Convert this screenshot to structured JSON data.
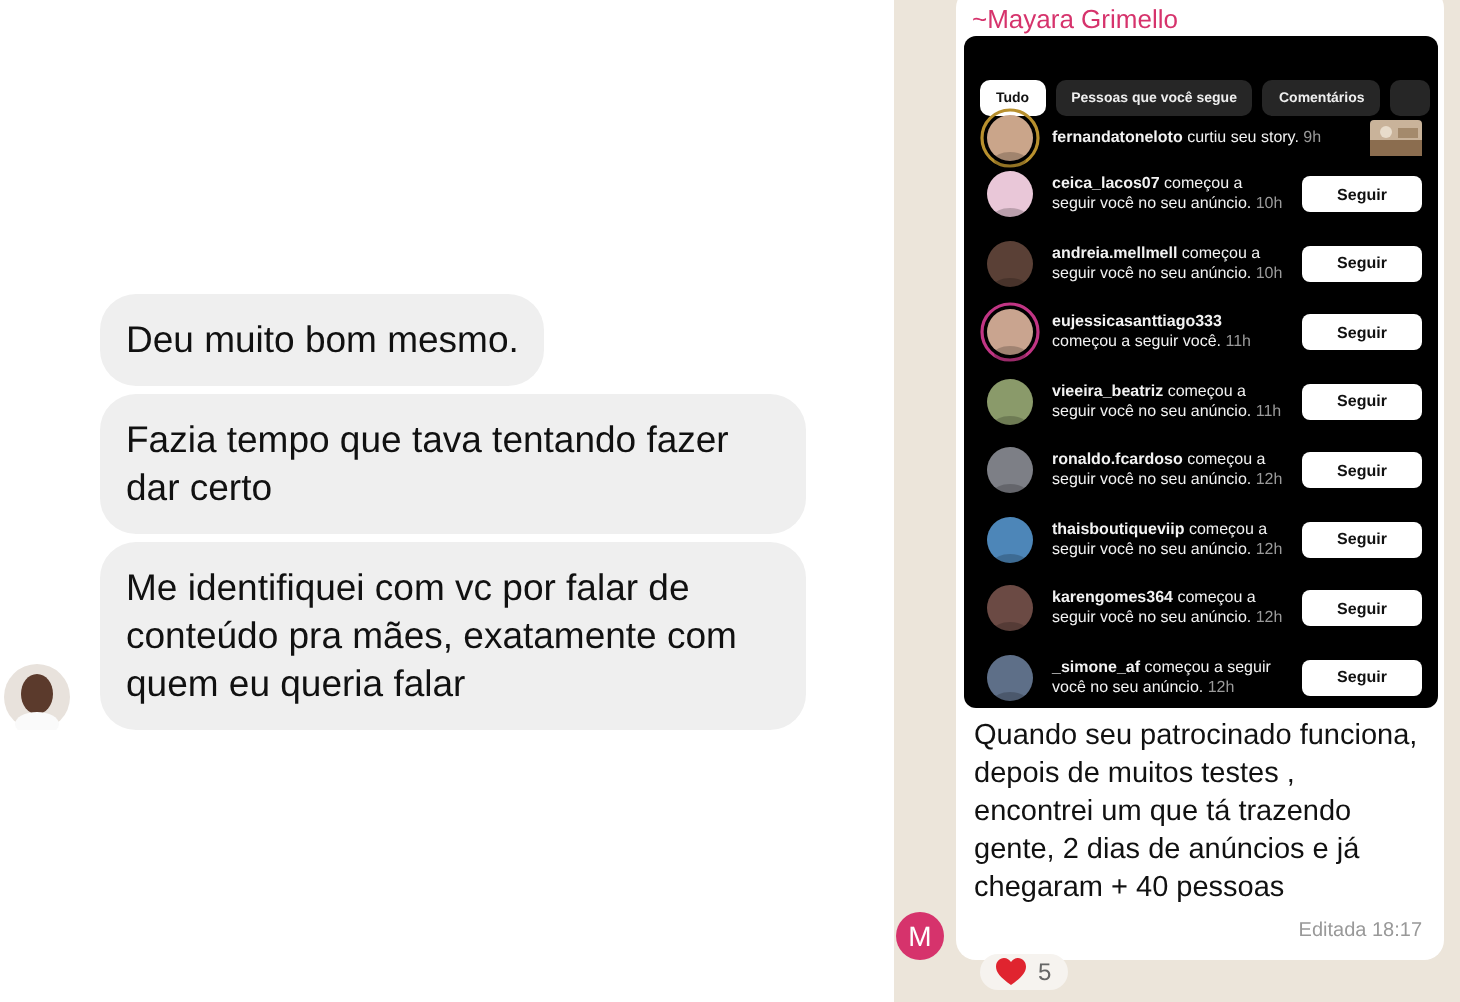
{
  "left_chat": {
    "messages": [
      {
        "text": "Deu muito bom mesmo."
      },
      {
        "text": "Fazia tempo que tava tentando fazer dar certo"
      },
      {
        "text": "Me identifiquei com vc por falar de conteúdo pra mães, exatamente com quem eu queria falar"
      }
    ]
  },
  "right_chat": {
    "sender": "~Mayara Grimello",
    "sender_initial": "M",
    "screenshot": {
      "tabs": [
        {
          "label": "Tudo",
          "selected": true
        },
        {
          "label": "Pessoas que você segue",
          "selected": false
        },
        {
          "label": "Comentários",
          "selected": false
        }
      ],
      "notifications": [
        {
          "kind": "like",
          "username": "fernandatoneloto",
          "action": "curtiu seu story.",
          "time": "9h",
          "story_ring": true
        },
        {
          "kind": "follow",
          "username": "ceica_lacos07",
          "action": "começou a seguir você no seu anúncio.",
          "time": "10h",
          "button": "Seguir",
          "story_ring": false
        },
        {
          "kind": "follow",
          "username": "andreia.mellmell",
          "action": "começou a seguir você no seu anúncio.",
          "time": "10h",
          "button": "Seguir",
          "story_ring": false
        },
        {
          "kind": "follow",
          "username": "eujessicasanttiago333",
          "action": "começou a seguir você.",
          "time": "11h",
          "button": "Seguir",
          "story_ring": true
        },
        {
          "kind": "follow",
          "username": "vieeira_beatriz",
          "action": "começou a seguir você no seu anúncio.",
          "time": "11h",
          "button": "Seguir",
          "story_ring": false
        },
        {
          "kind": "follow",
          "username": "ronaldo.fcardoso",
          "action": "começou a seguir você no seu anúncio.",
          "time": "12h",
          "button": "Seguir",
          "story_ring": false
        },
        {
          "kind": "follow",
          "username": "thaisboutiqueviip",
          "action": "começou a seguir você no seu anúncio.",
          "time": "12h",
          "button": "Seguir",
          "story_ring": false
        },
        {
          "kind": "follow",
          "username": "karengomes364",
          "action": "começou a seguir você no seu anúncio.",
          "time": "12h",
          "button": "Seguir",
          "story_ring": false
        },
        {
          "kind": "follow",
          "username": "_simone_af",
          "action": "começou a seguir você no seu anúncio.",
          "time": "12h",
          "button": "Seguir",
          "story_ring": false
        }
      ]
    },
    "caption_lines": [
      "Quando seu patrocinado funciona,",
      "depois de muitos testes ,",
      "encontrei um que tá trazendo",
      "gente, 2 dias de anúncios e já",
      "chegaram + 40 pessoas"
    ],
    "status": "Editada 18:17",
    "reaction": {
      "count": "5"
    }
  }
}
